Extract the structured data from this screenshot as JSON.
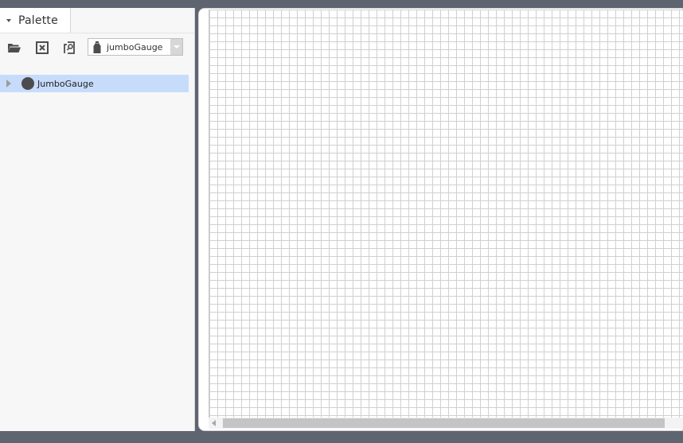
{
  "palette": {
    "title": "Palette",
    "toolbar": {
      "open_icon": "folder-open-icon",
      "close_icon": "close-box-icon",
      "find_icon": "find-icon",
      "module_select": {
        "value": "jumboGauge",
        "icon": "jar-icon"
      }
    },
    "tree": {
      "items": [
        {
          "label": "JumboGauge",
          "icon": "gauge-circle-icon",
          "expanded": false,
          "selected": true
        }
      ]
    }
  },
  "colors": {
    "selection": "#c7dcfb",
    "frame": "#5f6570",
    "grid_line": "#d0d0d0"
  }
}
